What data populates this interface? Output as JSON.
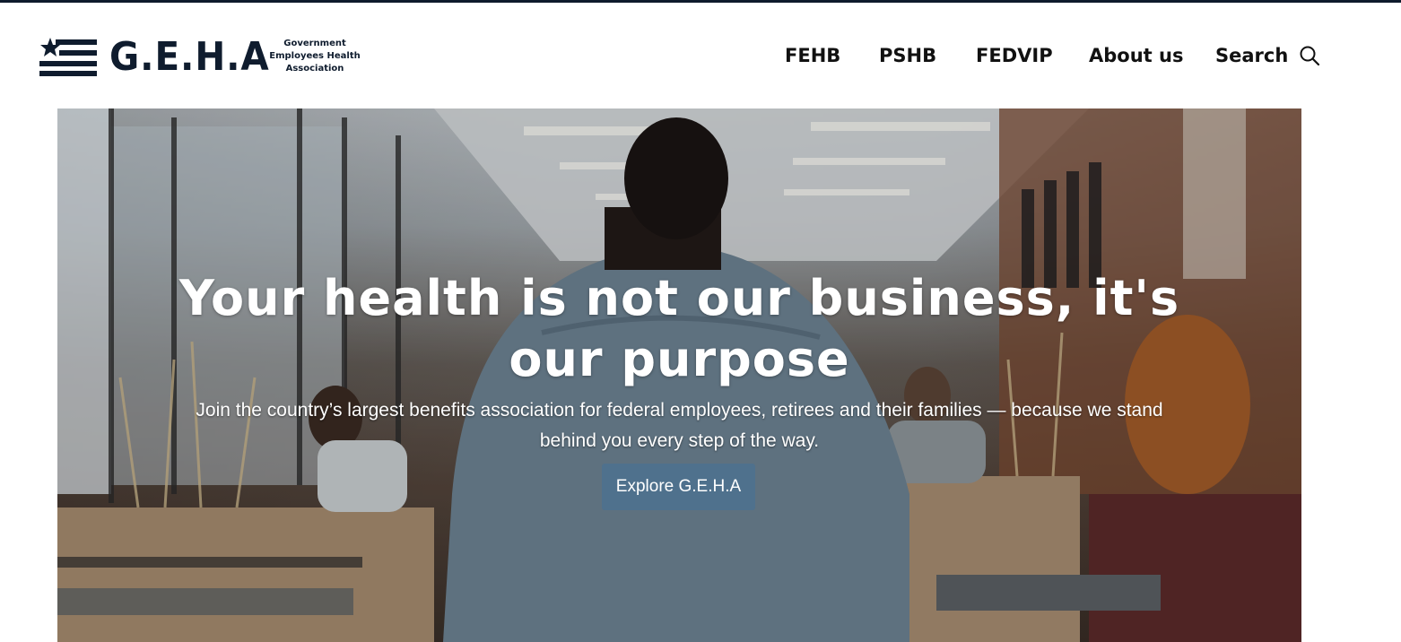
{
  "brand": {
    "logo_text": "G.E.H.A",
    "sub_line_1": "Government",
    "sub_line_2": "Employees Health",
    "sub_line_3": "Association",
    "color": "#0f1c2e"
  },
  "nav": {
    "items": [
      {
        "label": "FEHB"
      },
      {
        "label": "PSHB"
      },
      {
        "label": "FEDVIP"
      },
      {
        "label": "About us"
      }
    ],
    "search_label": "Search",
    "search_icon": "search-icon"
  },
  "hero": {
    "title_line_1": "Your health is not our business, it's",
    "title_line_2": "our purpose",
    "subtitle": "Join the country’s largest benefits association for federal employees, retirees and their families — because we stand behind you every step of the way.",
    "cta_label": "Explore G.E.H.A",
    "cta_color": "#4f718d"
  }
}
